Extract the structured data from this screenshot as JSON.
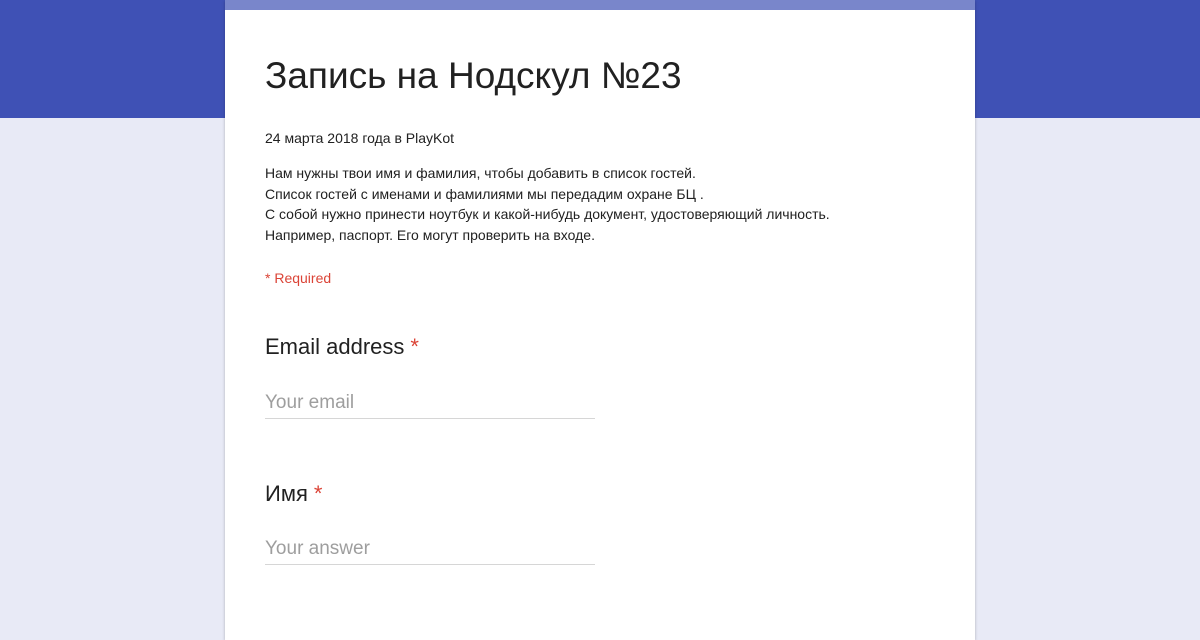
{
  "form": {
    "title": "Запись на Нодскул №23",
    "date": "24 марта 2018 года в PlayKot",
    "description": [
      "Нам нужны твои имя и фамилия, чтобы добавить в список гостей.",
      "Список гостей с именами и фамилиями мы передадим охране БЦ .",
      "С собой нужно принести ноутбук и какой-нибудь документ, удостоверяющий личность.",
      "Например, паспорт. Его могут проверить на входе."
    ],
    "required_note": "* Required",
    "questions": [
      {
        "label": "Email address",
        "required_mark": "*",
        "placeholder": "Your email",
        "value": ""
      },
      {
        "label": "Имя",
        "required_mark": "*",
        "placeholder": "Your answer",
        "value": ""
      }
    ]
  },
  "colors": {
    "header_band": "#3f51b5",
    "page_background": "#e8eaf6",
    "accent_bar": "#7986cb",
    "required": "#db4437"
  }
}
